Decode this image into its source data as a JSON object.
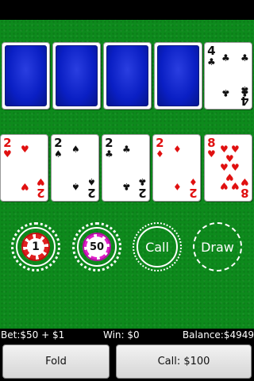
{
  "dealer_hand": {
    "hidden_count": 4,
    "visible_card": {
      "rank": "4",
      "suit": "♣",
      "color": "black"
    }
  },
  "player_hand": [
    {
      "rank": "2",
      "suit": "♥",
      "color": "red"
    },
    {
      "rank": "2",
      "suit": "♠",
      "color": "black"
    },
    {
      "rank": "2",
      "suit": "♣",
      "color": "black"
    },
    {
      "rank": "2",
      "suit": "♦",
      "color": "red"
    },
    {
      "rank": "8",
      "suit": "♥",
      "color": "red"
    }
  ],
  "chips": {
    "chip_1_label": "1",
    "chip_50_label": "50"
  },
  "actions": {
    "call_label": "Call",
    "draw_label": "Draw"
  },
  "info": {
    "bet": "Bet:$50 + $1",
    "win": "Win: $0",
    "balance": "Balance:$4949"
  },
  "buttons": {
    "fold_label": "Fold",
    "call_label": "Call: $100"
  },
  "colors": {
    "felt": "#0d8a1c",
    "card_back": "#0a1fc4",
    "suit_red": "#e01010",
    "chip_red": "#e02020",
    "chip_pink": "#e020c8"
  }
}
